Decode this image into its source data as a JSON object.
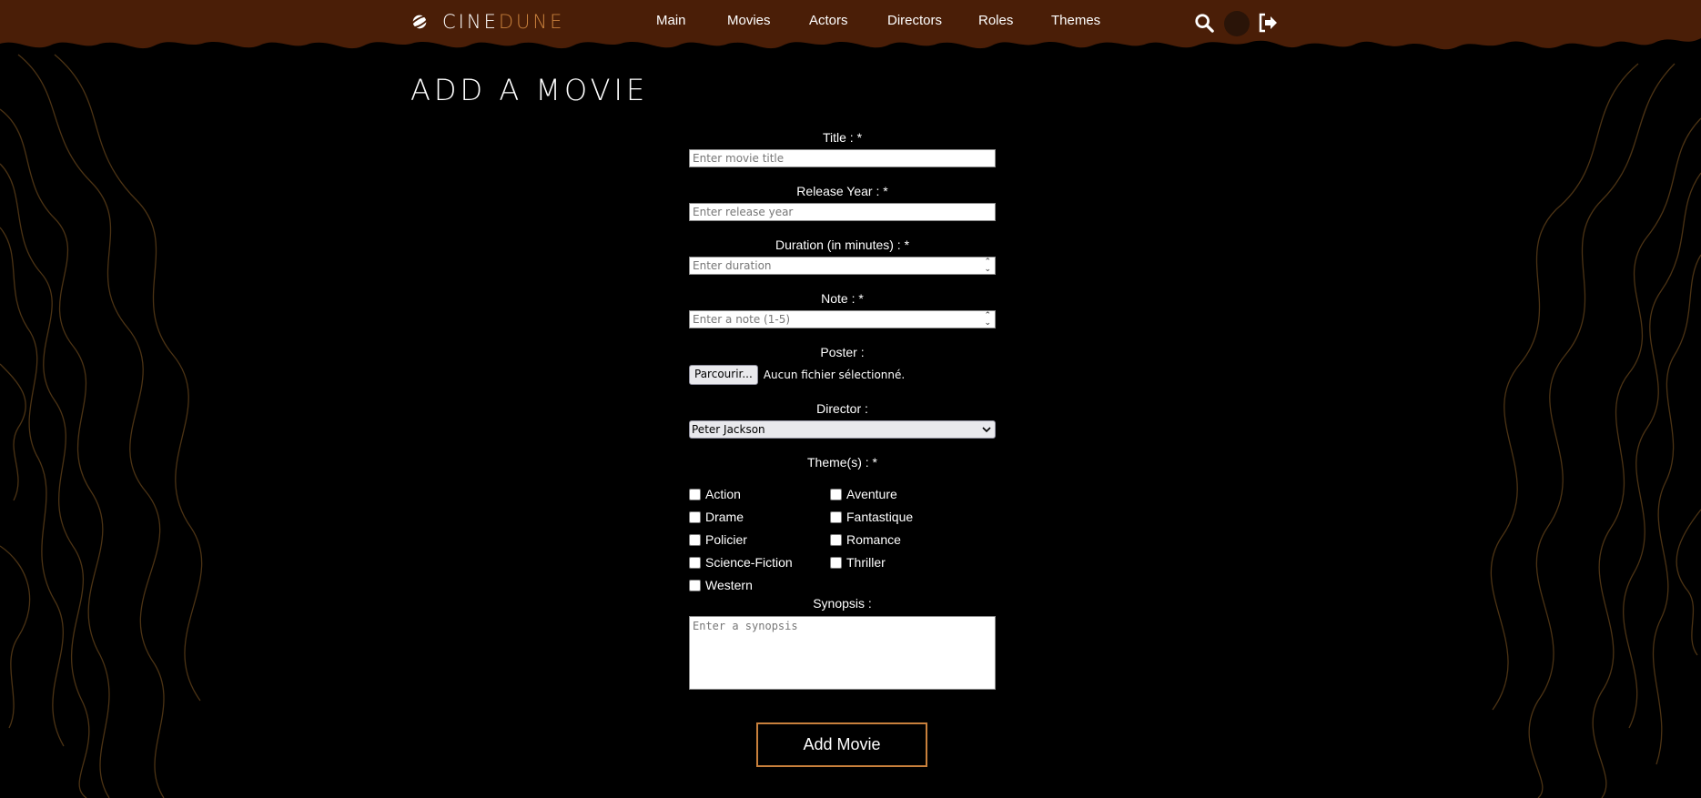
{
  "brand": {
    "name_part1": "CINE",
    "name_part2": "DUNE"
  },
  "nav": [
    "Main",
    "Movies",
    "Actors",
    "Directors",
    "Roles",
    "Themes"
  ],
  "page_title": "ADD A MOVIE",
  "form": {
    "title": {
      "label": "Title : *",
      "placeholder": "Enter movie title"
    },
    "release_year": {
      "label": "Release Year : *",
      "placeholder": "Enter release year"
    },
    "duration": {
      "label": "Duration (in minutes) : *",
      "placeholder": "Enter duration"
    },
    "note": {
      "label": "Note : *",
      "placeholder": "Enter a note (1-5)"
    },
    "poster": {
      "label": "Poster :",
      "button": "Parcourir...",
      "status": "Aucun fichier sélectionné."
    },
    "director": {
      "label": "Director :",
      "selected": "Peter Jackson"
    },
    "themes": {
      "label": "Theme(s) : *",
      "options": [
        "Action",
        "Aventure",
        "Drame",
        "Fantastique",
        "Policier",
        "Romance",
        "Science-Fiction",
        "Thriller",
        "Western"
      ]
    },
    "synopsis": {
      "label": "Synopsis :",
      "placeholder": "Enter a synopsis"
    },
    "submit_label": "Add Movie"
  },
  "colors": {
    "header_brown": "#4a1e07",
    "accent": "#c8803c",
    "background": "#000000",
    "topo_lines": "#6b4a1f"
  },
  "icons": {
    "brand": "planet-icon",
    "search": "search-icon",
    "logout": "logout-icon",
    "select_arrow": "chevron-down-icon",
    "spinner": "spin-arrows-icon"
  }
}
